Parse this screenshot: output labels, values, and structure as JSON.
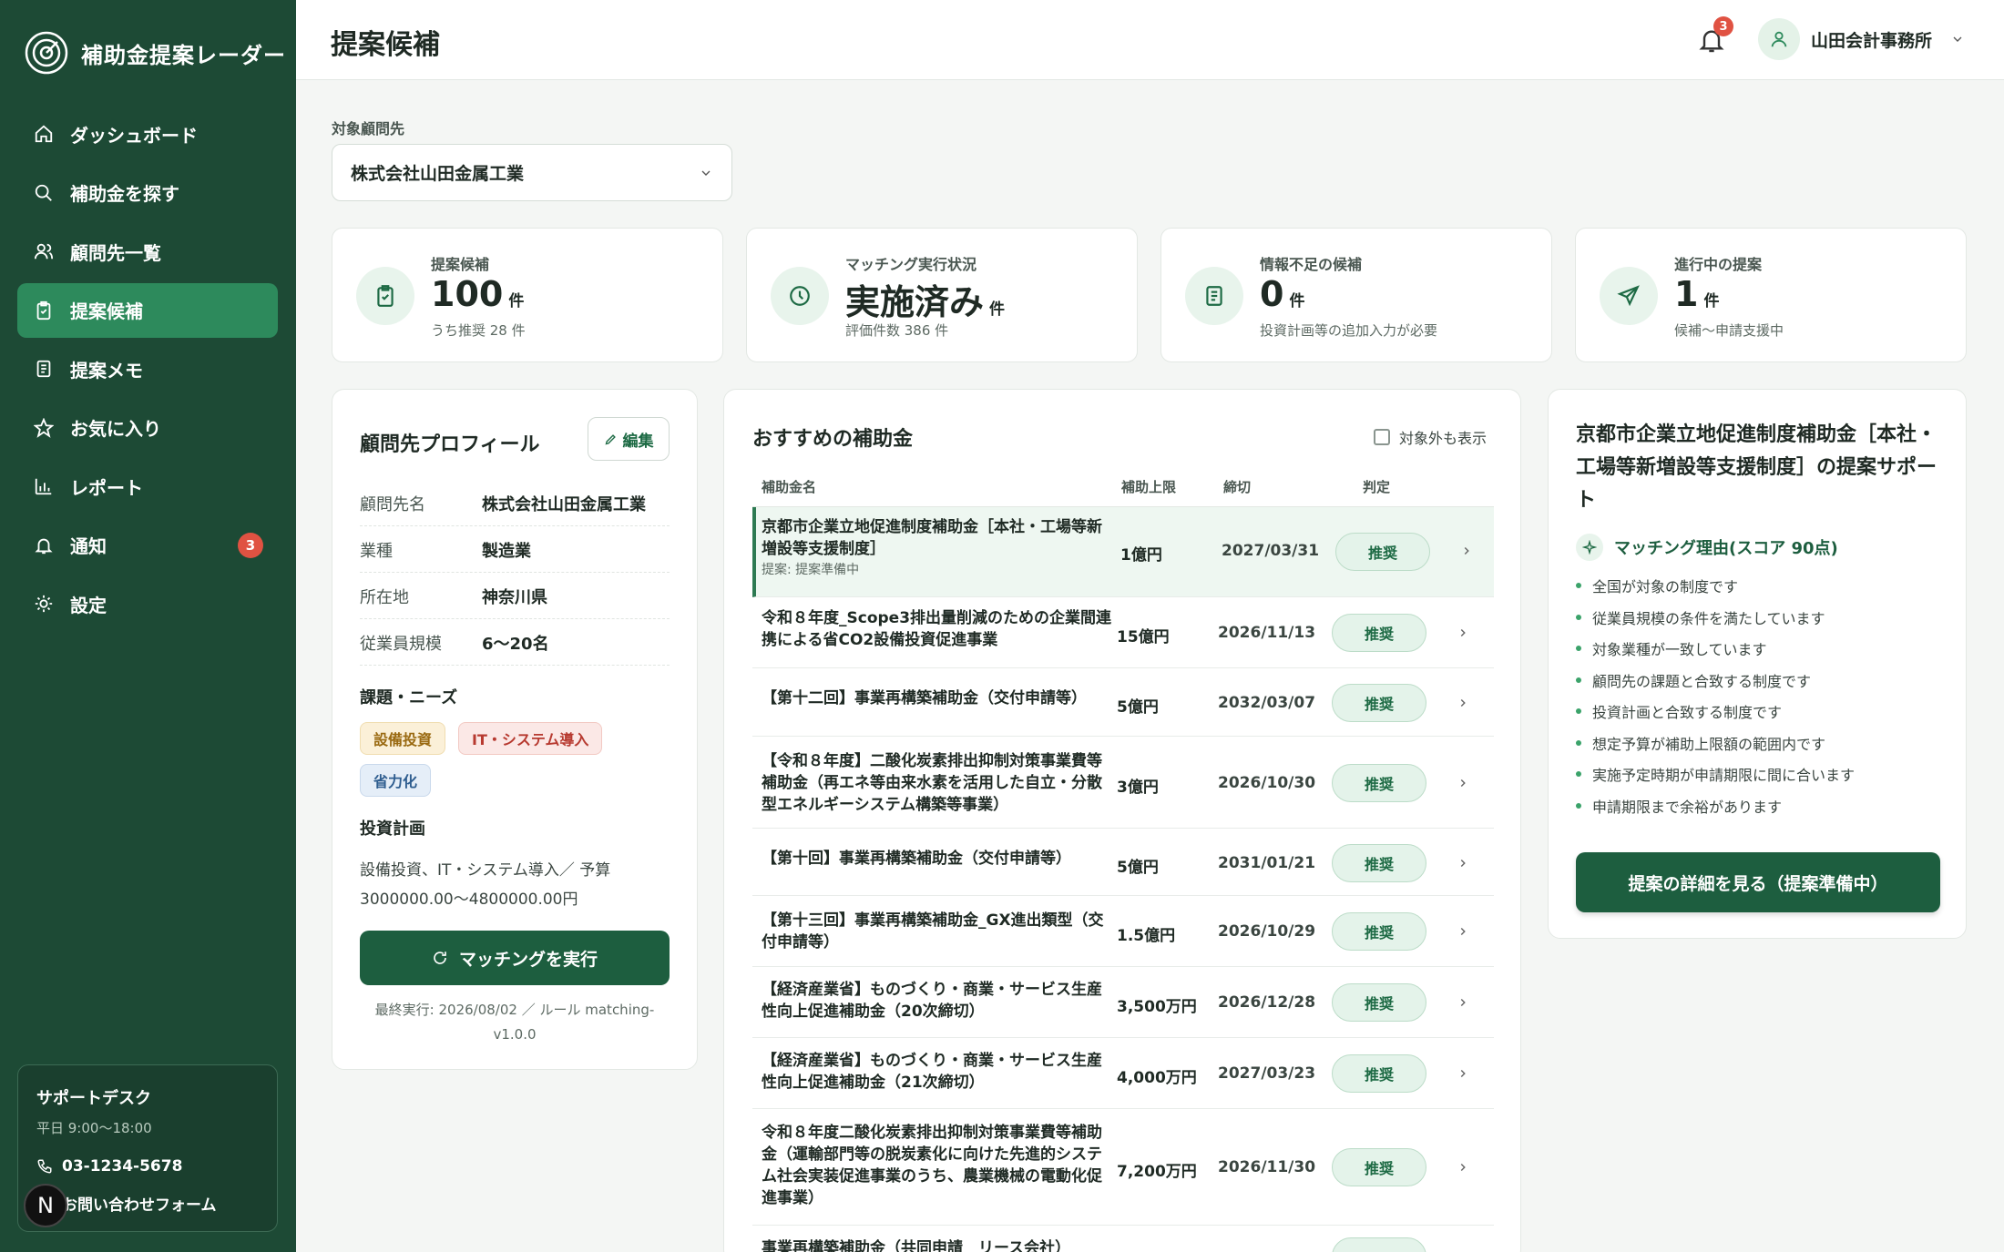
{
  "app": {
    "name": "補助金提案レーダー"
  },
  "sidebar": {
    "items": [
      {
        "label": "ダッシュボード",
        "icon": "home-icon"
      },
      {
        "label": "補助金を探す",
        "icon": "search-icon"
      },
      {
        "label": "顧問先一覧",
        "icon": "users-icon"
      },
      {
        "label": "提案候補",
        "icon": "clipboard-check-icon",
        "active": true
      },
      {
        "label": "提案メモ",
        "icon": "document-icon"
      },
      {
        "label": "お気に入り",
        "icon": "star-icon"
      },
      {
        "label": "レポート",
        "icon": "bar-chart-icon"
      },
      {
        "label": "通知",
        "icon": "bell-icon",
        "badge": "3"
      },
      {
        "label": "設定",
        "icon": "gear-icon"
      }
    ],
    "support": {
      "title": "サポートデスク",
      "hours": "平日 9:00〜18:00",
      "phone": "03-1234-5678",
      "form": "お問い合わせフォーム"
    }
  },
  "header": {
    "title": "提案候補",
    "notification_count": "3",
    "user": "山田会計事務所"
  },
  "filter": {
    "label": "対象顧問先",
    "value": "株式会社山田金属工業"
  },
  "stats": [
    {
      "label": "提案候補",
      "value": "100",
      "unit": "件",
      "sub": "うち推奨 28 件"
    },
    {
      "label": "マッチング実行状況",
      "value": "実施済み",
      "unit": "件",
      "sub": "評価件数 386 件"
    },
    {
      "label": "情報不足の候補",
      "value": "0",
      "unit": "件",
      "sub": "投資計画等の追加入力が必要"
    },
    {
      "label": "進行中の提案",
      "value": "1",
      "unit": "件",
      "sub": "候補〜申請支援中"
    }
  ],
  "profile": {
    "title": "顧問先プロフィール",
    "edit": "編集",
    "rows": [
      {
        "k": "顧問先名",
        "v": "株式会社山田金属工業"
      },
      {
        "k": "業種",
        "v": "製造業"
      },
      {
        "k": "所在地",
        "v": "神奈川県"
      },
      {
        "k": "従業員規模",
        "v": "6〜20名"
      }
    ],
    "needs_title": "課題・ニーズ",
    "tags": [
      "設備投資",
      "IT・システム導入",
      "省力化"
    ],
    "invest_title": "投資計画",
    "invest_text": "設備投資、IT・システム導入／ 予算 3000000.00〜4800000.00円",
    "run_button": "マッチングを実行",
    "last_run": "最終実行: 2026/08/02 ／ ルール matching-v1.0.0"
  },
  "subsidies": {
    "title": "おすすめの補助金",
    "show_excluded": "対象外も表示",
    "columns": [
      "補助金名",
      "補助上限",
      "締切",
      "判定"
    ],
    "rows": [
      {
        "name": "京都市企業立地促進制度補助金［本社・工場等新増設等支援制度］",
        "sub": "提案: 提案準備中",
        "amount": "1億円",
        "deadline": "2027/03/31",
        "verdict": "推奨"
      },
      {
        "name": "令和８年度_Scope3排出量削減のための企業間連携による省CO2設備投資促進事業",
        "amount": "15億円",
        "deadline": "2026/11/13",
        "verdict": "推奨"
      },
      {
        "name": "【第十二回】事業再構築補助金（交付申請等）",
        "amount": "5億円",
        "deadline": "2032/03/07",
        "verdict": "推奨"
      },
      {
        "name": "【令和８年度】二酸化炭素排出抑制対策事業費等補助金（再エネ等由来水素を活用した自立・分散型エネルギーシステム構築等事業）",
        "amount": "3億円",
        "deadline": "2026/10/30",
        "verdict": "推奨"
      },
      {
        "name": "【第十回】事業再構築補助金（交付申請等）",
        "amount": "5億円",
        "deadline": "2031/01/21",
        "verdict": "推奨"
      },
      {
        "name": "【第十三回】事業再構築補助金_GX進出類型（交付申請等）",
        "amount": "1.5億円",
        "deadline": "2026/10/29",
        "verdict": "推奨"
      },
      {
        "name": "【経済産業省】ものづくり・商業・サービス生産性向上促進補助金（20次締切）",
        "amount": "3,500万円",
        "deadline": "2026/12/28",
        "verdict": "推奨"
      },
      {
        "name": "【経済産業省】ものづくり・商業・サービス生産性向上促進補助金（21次締切）",
        "amount": "4,000万円",
        "deadline": "2027/03/23",
        "verdict": "推奨"
      },
      {
        "name": "令和８年度二酸化炭素排出抑制対策事業費等補助金（運輸部門等の脱炭素化に向けた先進的システム社会実装促進事業のうち、農業機械の電動化促進事業）",
        "amount": "7,200万円",
        "deadline": "2026/11/30",
        "verdict": "推奨"
      },
      {
        "name": "事業再構築補助金（共同申請　リース会社）",
        "amount": "",
        "deadline": "",
        "verdict": ""
      }
    ]
  },
  "proposal": {
    "title": "京都市企業立地促進制度補助金［本社・工場等新増設等支援制度］の提案サポート",
    "reason_title": "マッチング理由(スコア 90点)",
    "reasons": [
      "全国が対象の制度です",
      "従業員規模の条件を満たしています",
      "対象業種が一致しています",
      "顧問先の課題と合致する制度です",
      "投資計画と合致する制度です",
      "想定予算が補助上限額の範囲内です",
      "実施予定時期が申請期限に間に合います",
      "申請期限まで余裕があります"
    ],
    "button": "提案の詳細を見る（提案準備中）"
  },
  "colors": {
    "sidebar": "#1d4a35",
    "accent": "#2d8a5c",
    "primary_button": "#1d5e3f",
    "badge": "#e05242"
  }
}
